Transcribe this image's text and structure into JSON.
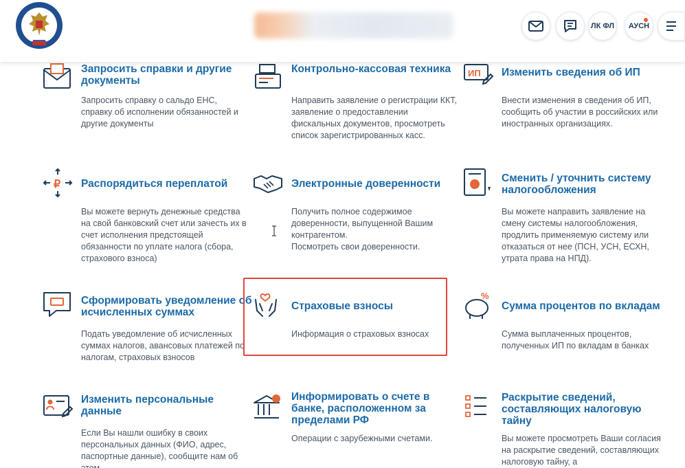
{
  "header": {
    "logo_alt": "ФЕДЕРАЛЬНАЯ НАЛОГОВАЯ СЛУЖБА",
    "buttons": {
      "lk_fl": "ЛК ФЛ",
      "ausn": "АУСН"
    }
  },
  "colors": {
    "accent": "#1c6aa8",
    "highlight": "#e0453e"
  },
  "services": [
    {
      "title": "Запросить справки и другие документы",
      "desc": "Запросить справку о сальдо ЕНС, справку об исполнении обязанностей и другие документы",
      "icon": "document-envelope-icon"
    },
    {
      "title": "Контрольно-кассовая техника",
      "desc": "Направить заявление о регистрации ККТ, заявление о предоставлении фискальных документов, просмотреть список зарегистрированных касс.",
      "icon": "cash-register-icon"
    },
    {
      "title": "Изменить сведения об ИП",
      "desc": "Внести изменения в сведения об ИП, сообщить об участии в российских или иностранных организациях.",
      "icon": "ip-edit-icon"
    },
    {
      "title": "Распорядиться переплатой",
      "desc": "Вы можете вернуть денежные средства на свой банковский счет или зачесть их в счет исполнения предстоящей обязанности по уплате налога (сбора, страхового взноса)",
      "icon": "ruble-arrows-icon"
    },
    {
      "title": "Электронные доверенности",
      "desc": "Получить полное содержимое доверенности, выпущенной Вашим контрагентом.\nПосмотреть свои доверенности.",
      "icon": "handshake-icon"
    },
    {
      "title": "Сменить / уточнить систему налогообложения",
      "desc": "Вы можете направить заявление на смену системы налогообложения, продлить применяемую систему или отказаться от нее (ПСН, УСН, ЕСХН, утрата права на НПД).",
      "icon": "tax-system-document-icon"
    },
    {
      "title": "Сформировать уведомление об исчисленных суммах",
      "desc": "Подать уведомление об исчисленных суммах налогов, авансовых платежей по налогам, страховых взносов",
      "icon": "notification-chat-icon"
    },
    {
      "title": "Страховые взносы",
      "desc": "Информация о страховых взносах",
      "icon": "hands-heart-icon"
    },
    {
      "title": "Сумма процентов по вкладам",
      "desc": "Сумма выплаченных процентов, полученных ИП по вкладам в банках",
      "icon": "piggy-bank-percent-icon"
    },
    {
      "title": "Изменить персональные данные",
      "desc": "Если Вы нашли ошибку в своих персональных данных (ФИО, адрес, паспортные данные), сообщите нам об этом.",
      "icon": "person-card-edit-icon"
    },
    {
      "title": "Информировать о счете в банке, расположенном за пределами РФ",
      "desc": "Операции с зарубежными счетами.",
      "icon": "bank-building-icon"
    },
    {
      "title": "Раскрытие сведений, составляющих налоговую тайну",
      "desc": "Вы можете просмотреть Ваши согласия на раскрытие сведений, составляющих налоговую тайну, а",
      "icon": "checklist-icon"
    }
  ]
}
